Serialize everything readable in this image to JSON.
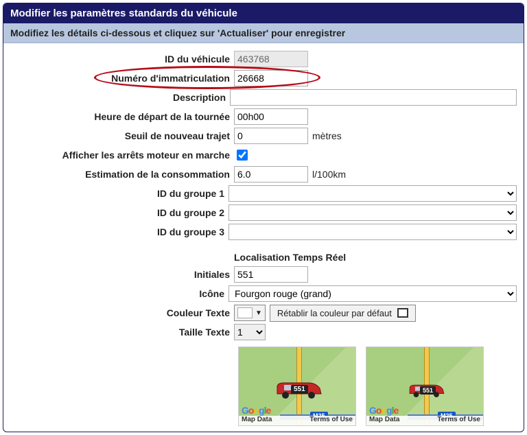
{
  "header": {
    "title": "Modifier les paramètres standards du véhicule",
    "subtitle": "Modifiez les détails ci-dessous et cliquez sur 'Actualiser' pour enregistrer"
  },
  "form": {
    "vehicle_id": {
      "label": "ID du véhicule",
      "value": "463768"
    },
    "registration": {
      "label": "Numéro d'immatriculation",
      "value": "26668"
    },
    "description": {
      "label": "Description",
      "value": ""
    },
    "route_start": {
      "label": "Heure de départ de la tournée",
      "value": "00h00"
    },
    "new_journey_threshold": {
      "label": "Seuil de nouveau trajet",
      "value": "0",
      "suffix": "mètres"
    },
    "show_engine_stops": {
      "label": "Afficher les arrêts moteur en marche",
      "checked": true
    },
    "fuel_estimate": {
      "label": "Estimation de la consommation",
      "value": "6.0",
      "suffix": "l/100km"
    },
    "group1": {
      "label": "ID du groupe 1",
      "value": ""
    },
    "group2": {
      "label": "ID du groupe 2",
      "value": ""
    },
    "group3": {
      "label": "ID du groupe 3",
      "value": ""
    }
  },
  "realtime": {
    "section_label": "Localisation Temps Réel",
    "initials": {
      "label": "Initiales",
      "value": "551"
    },
    "icon": {
      "label": "Icône",
      "value": "Fourgon rouge (grand)"
    },
    "text_color": {
      "label": "Couleur Texte",
      "reset_label": "Rétablir la couleur par défaut",
      "swatch": "#ffffff"
    },
    "text_size": {
      "label": "Taille Texte",
      "value": "1"
    },
    "preview": {
      "badge": "551",
      "road_badge": "M25",
      "logo": "Google",
      "map_data": "Map Data",
      "terms": "Terms of Use"
    }
  }
}
